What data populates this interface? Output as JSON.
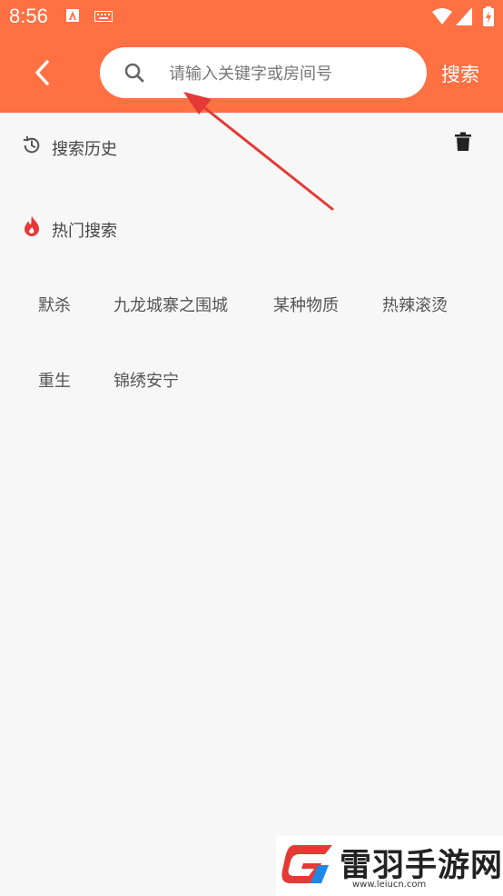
{
  "status_bar": {
    "time": "8:56"
  },
  "header": {
    "search_placeholder": "请输入关键字或房间号",
    "search_button": "搜索"
  },
  "history": {
    "title": "搜索历史"
  },
  "hot": {
    "title": "热门搜索",
    "tags": [
      "默杀",
      "九龙城寨之围城",
      "某种物质",
      "热辣滚烫",
      "重生",
      "锦绣安宁"
    ]
  },
  "watermark": {
    "name": "雷羽手游网",
    "url": "www.leiucn.com"
  },
  "colors": {
    "accent": "#ff7043",
    "flame": "#e53935",
    "arrow": "#e53935"
  }
}
